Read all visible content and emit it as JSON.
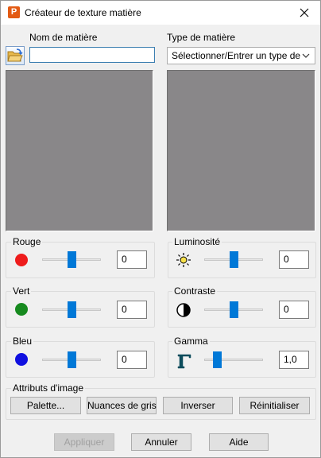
{
  "window": {
    "title": "Créateur de texture matière",
    "app_icon_letter": "P"
  },
  "name_field": {
    "label": "Nom de matière",
    "value": ""
  },
  "type_field": {
    "label": "Type de matière",
    "value": "Sélectionner/Entrer un type de"
  },
  "groups": {
    "red": {
      "label": "Rouge",
      "value": "0",
      "slider_level": 0.5,
      "color": "#ee1c1c"
    },
    "green": {
      "label": "Vert",
      "value": "0",
      "slider_level": 0.5,
      "color": "#178a1f"
    },
    "blue": {
      "label": "Bleu",
      "value": "0",
      "slider_level": 0.5,
      "color": "#1010e0"
    },
    "brightness": {
      "label": "Luminosité",
      "value": "0",
      "slider_level": 0.5
    },
    "contrast": {
      "label": "Contraste",
      "value": "0",
      "slider_level": 0.5
    },
    "gamma": {
      "label": "Gamma",
      "value": "1,0",
      "slider_level": 0.2
    }
  },
  "image_attributes": {
    "label": "Attributs d'image",
    "buttons": [
      "Palette...",
      "Nuances de gris",
      "Inverser",
      "Réinitialiser"
    ]
  },
  "footer": {
    "apply": "Appliquer",
    "cancel": "Annuler",
    "help": "Aide"
  },
  "accent_color": "#0078d7",
  "preview_color": "#898789"
}
